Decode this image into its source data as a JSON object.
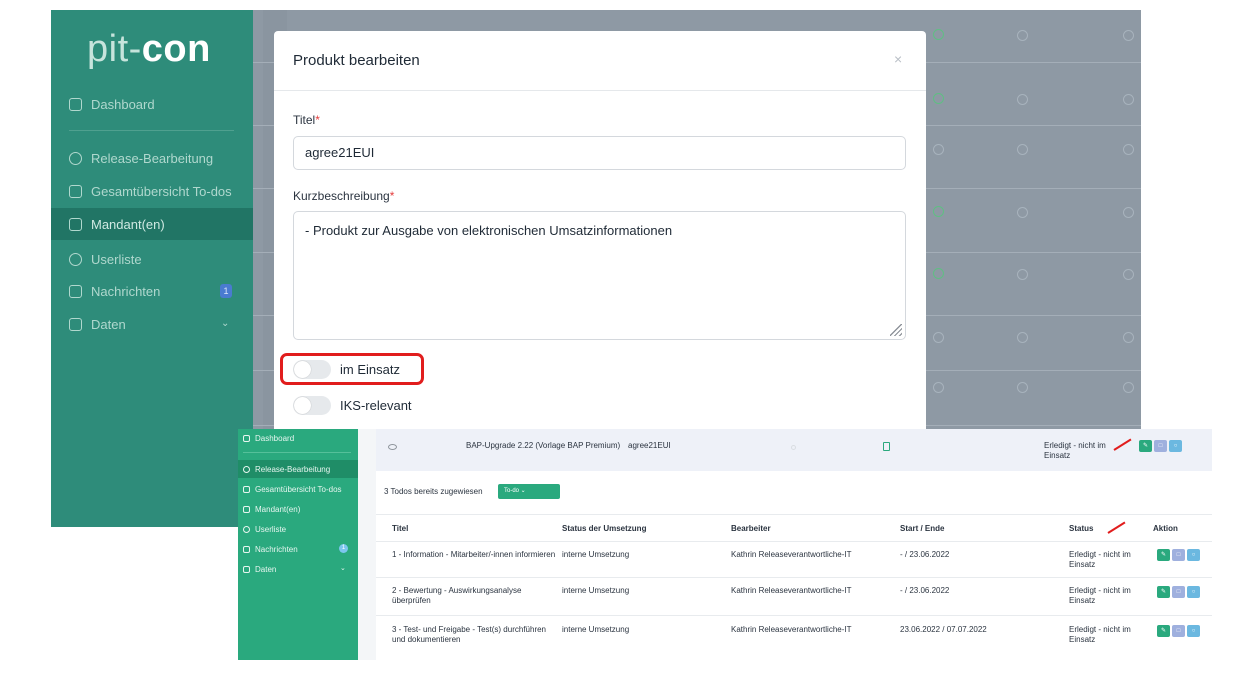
{
  "back": {
    "logo_light": "pit-",
    "logo_bold": "con",
    "nav": [
      {
        "label": "Dashboard"
      },
      {
        "label": "Release-Bearbeitung"
      },
      {
        "label": "Gesamtübersicht To-dos"
      },
      {
        "label": "Mandant(en)"
      },
      {
        "label": "Userliste"
      },
      {
        "label": "Nachrichten",
        "badge": "1"
      },
      {
        "label": "Daten"
      }
    ]
  },
  "modal": {
    "title": "Produkt bearbeiten",
    "close": "×",
    "title_label": "Titel",
    "title_value": "agree21EUI",
    "desc_label": "Kurzbeschreibung",
    "desc_value": "- Produkt zur Ausgabe von elektronischen Umsatzinformationen",
    "required_mark": "*",
    "toggle_einsatz": "im Einsatz",
    "toggle_iks": "IKS-relevant"
  },
  "front": {
    "nav": [
      {
        "label": "Dashboard"
      },
      {
        "label": "Release-Bearbeitung"
      },
      {
        "label": "Gesamtübersicht To-dos"
      },
      {
        "label": "Mandant(en)"
      },
      {
        "label": "Userliste"
      },
      {
        "label": "Nachrichten",
        "badge": "1"
      },
      {
        "label": "Daten"
      }
    ],
    "release": {
      "name": "BAP-Upgrade 2.22 (Vorlage BAP Premium)",
      "product": "agree21EUI",
      "status": "Erledigt - nicht im Einsatz"
    },
    "assigned_text": "3 Todos bereits zugewiesen",
    "todo_button": "To-do",
    "columns": [
      "Titel",
      "Status der Umsetzung",
      "Bearbeiter",
      "Start / Ende",
      "Status",
      "Aktion"
    ],
    "rows": [
      {
        "title": "1 - Information - Mitarbeiter/-innen informieren",
        "umsetzung": "interne Umsetzung",
        "bearbeiter": "Kathrin Releaseverantwortliche-IT",
        "dates": "- / 23.06.2022",
        "status": "Erledigt - nicht im Einsatz"
      },
      {
        "title": "2 - Bewertung - Auswirkungsanalyse überprüfen",
        "umsetzung": "interne Umsetzung",
        "bearbeiter": "Kathrin Releaseverantwortliche-IT",
        "dates": "- / 23.06.2022",
        "status": "Erledigt - nicht im Einsatz"
      },
      {
        "title": "3 - Test- und Freigabe - Test(s) durchführen und dokumentieren",
        "umsetzung": "interne Umsetzung",
        "bearbeiter": "Kathrin Releaseverantwortliche-IT",
        "dates": "23.06.2022 / 07.07.2022",
        "status": "Erledigt - nicht im Einsatz"
      }
    ]
  }
}
